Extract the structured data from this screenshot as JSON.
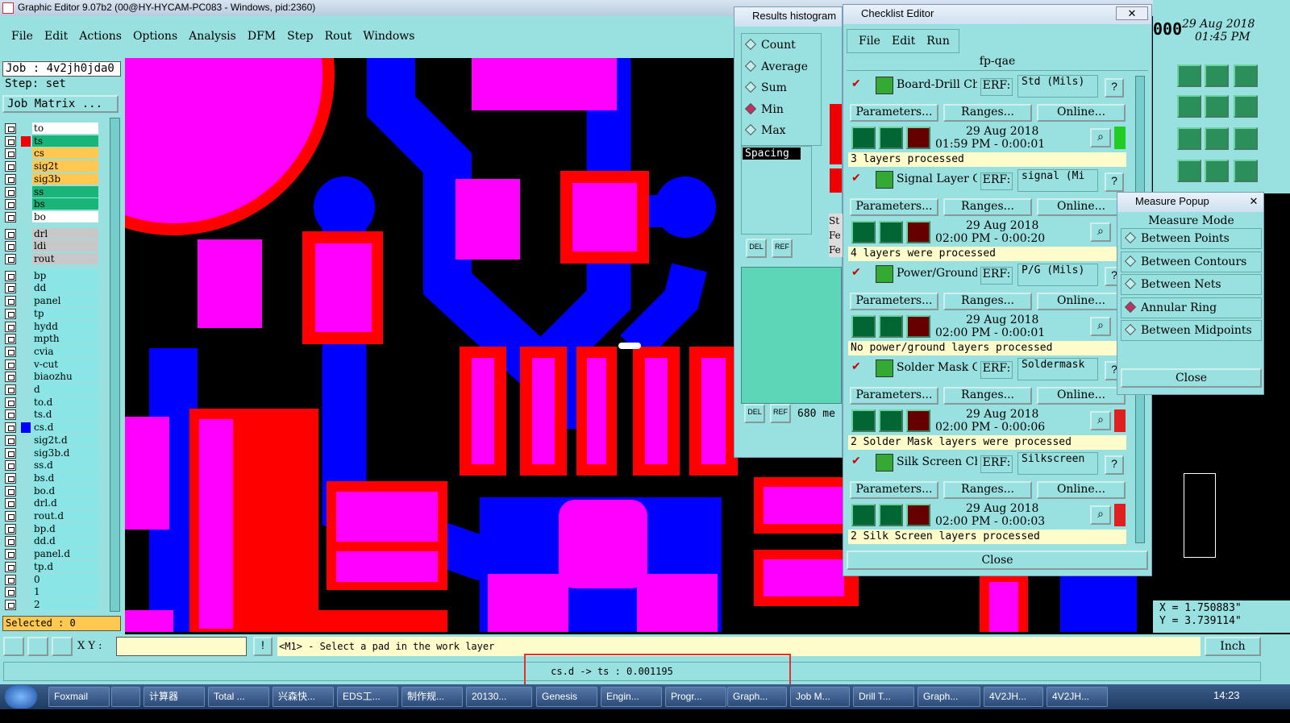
{
  "window": {
    "title": "Graphic Editor 9.07b2 (00@HY-HYCAM-PC083 - Windows, pid:2360)",
    "clock_top": "29 Aug 2018",
    "clock_time": "01:45 PM",
    "clock_frag": "000"
  },
  "menu": [
    "File",
    "Edit",
    "Actions",
    "Options",
    "Analysis",
    "DFM",
    "Step",
    "Rout",
    "Windows"
  ],
  "left": {
    "job": "Job : 4v2jh0jda0",
    "step": "Step: set",
    "job_matrix": "Job Matrix ...",
    "selected": "Selected : 0",
    "layers": [
      {
        "name": "to",
        "color": "#ffffff"
      },
      {
        "name": "ts",
        "color": "#18b478"
      },
      {
        "name": "cs",
        "color": "#ffc850"
      },
      {
        "name": "sig2t",
        "color": "#ffc850"
      },
      {
        "name": "sig3b",
        "color": "#ffc850"
      },
      {
        "name": "ss",
        "color": "#18b478"
      },
      {
        "name": "bs",
        "color": "#18b478"
      },
      {
        "name": "bo",
        "color": "#ffffff"
      },
      {
        "name": "drl",
        "color": "#c8c8c8"
      },
      {
        "name": "ldi",
        "color": "#c8c8c8"
      },
      {
        "name": "rout",
        "color": "#c8c8c8"
      },
      {
        "name": "bp",
        "color": "#8ae6e6"
      },
      {
        "name": "dd",
        "color": "#8ae6e6"
      },
      {
        "name": "panel",
        "color": "#8ae6e6"
      },
      {
        "name": "tp",
        "color": "#8ae6e6"
      },
      {
        "name": "hydd",
        "color": "#8ae6e6"
      },
      {
        "name": "mpth",
        "color": "#8ae6e6"
      },
      {
        "name": "cvia",
        "color": "#8ae6e6"
      },
      {
        "name": "v-cut",
        "color": "#8ae6e6"
      },
      {
        "name": "biaozhu",
        "color": "#8ae6e6"
      },
      {
        "name": "d",
        "color": "#8ae6e6"
      },
      {
        "name": "to.d",
        "color": "#8ae6e6"
      },
      {
        "name": "ts.d",
        "color": "#8ae6e6"
      },
      {
        "name": "cs.d",
        "color": "#8ae6e6"
      },
      {
        "name": "sig2t.d",
        "color": "#8ae6e6"
      },
      {
        "name": "sig3b.d",
        "color": "#8ae6e6"
      },
      {
        "name": "ss.d",
        "color": "#8ae6e6"
      },
      {
        "name": "bs.d",
        "color": "#8ae6e6"
      },
      {
        "name": "bo.d",
        "color": "#8ae6e6"
      },
      {
        "name": "drl.d",
        "color": "#8ae6e6"
      },
      {
        "name": "rout.d",
        "color": "#8ae6e6"
      },
      {
        "name": "bp.d",
        "color": "#8ae6e6"
      },
      {
        "name": "dd.d",
        "color": "#8ae6e6"
      },
      {
        "name": "panel.d",
        "color": "#8ae6e6"
      },
      {
        "name": "tp.d",
        "color": "#8ae6e6"
      },
      {
        "name": "0",
        "color": "#8ae6e6"
      },
      {
        "name": "1",
        "color": "#8ae6e6"
      },
      {
        "name": "2",
        "color": "#8ae6e6"
      }
    ]
  },
  "status": {
    "xy_label": "X Y :",
    "xy_value": "",
    "prompt": "<M1> - Select a pad in the work layer",
    "units": "Inch",
    "measure": "cs.d -> ts : 0.001195"
  },
  "coords": {
    "x": "X = 1.750883\"",
    "y": "Y = 3.739114\""
  },
  "histogram": {
    "title": "Results histogram",
    "options": [
      "Count",
      "Average",
      "Sum",
      "Min",
      "Max"
    ],
    "selected": "Min",
    "list_item": "Spacing",
    "del": "DEL",
    "ref": "REF",
    "count_text": "680 me",
    "side_frag": [
      "St",
      "Fe",
      "Fe"
    ]
  },
  "checklist": {
    "title": "Checklist Editor",
    "menu": [
      "File",
      "Edit",
      "Run"
    ],
    "name": "fp-qae",
    "close": "Close",
    "erf": "ERF:",
    "params": "Parameters...",
    "ranges": "Ranges...",
    "online": "Online...",
    "actions": [
      {
        "name": "Board-Drill Che",
        "erf": "Std (Mils)",
        "date": "29 Aug 2018",
        "time": "01:59 PM - 0:00:01",
        "result": "3 layers processed",
        "status_color": "#22cc22"
      },
      {
        "name": "Signal Layer Ch",
        "erf": "signal (Mi",
        "date": "29 Aug 2018",
        "time": "02:00 PM - 0:00:20",
        "result": "4 layers were processed",
        "status_color": ""
      },
      {
        "name": "Power/Ground C",
        "erf": "P/G (Mils)",
        "date": "29 Aug 2018",
        "time": "02:00 PM - 0:00:01",
        "result": "No power/ground layers processed",
        "status_color": ""
      },
      {
        "name": "Solder Mask Ch",
        "erf": "Soldermask",
        "date": "29 Aug 2018",
        "time": "02:00 PM - 0:00:06",
        "result": "2 Solder Mask layers were processed",
        "status_color": "#e02020"
      },
      {
        "name": "Silk Screen Che",
        "erf": "Silkscreen",
        "date": "29 Aug 2018",
        "time": "02:00 PM - 0:00:03",
        "result": "2 Silk Screen layers processed",
        "status_color": "#e02020"
      }
    ]
  },
  "measure": {
    "title": "Measure Popup",
    "mode": "Measure Mode",
    "options": [
      "Between Points",
      "Between Contours",
      "Between Nets",
      "Annular Ring",
      "Between Midpoints"
    ],
    "selected": "Annular Ring",
    "close": "Close"
  },
  "taskbar": [
    "Foxmail",
    "",
    "计算器",
    "Total ...",
    "兴森快...",
    "EDS工...",
    "制作规...",
    "20130...",
    "Genesis",
    "Engin...",
    "Progr...",
    "Graph...",
    "Job M...",
    "Drill T...",
    "Graph...",
    "4V2JH...",
    "4V2JH..."
  ],
  "tray_time": "14:23"
}
